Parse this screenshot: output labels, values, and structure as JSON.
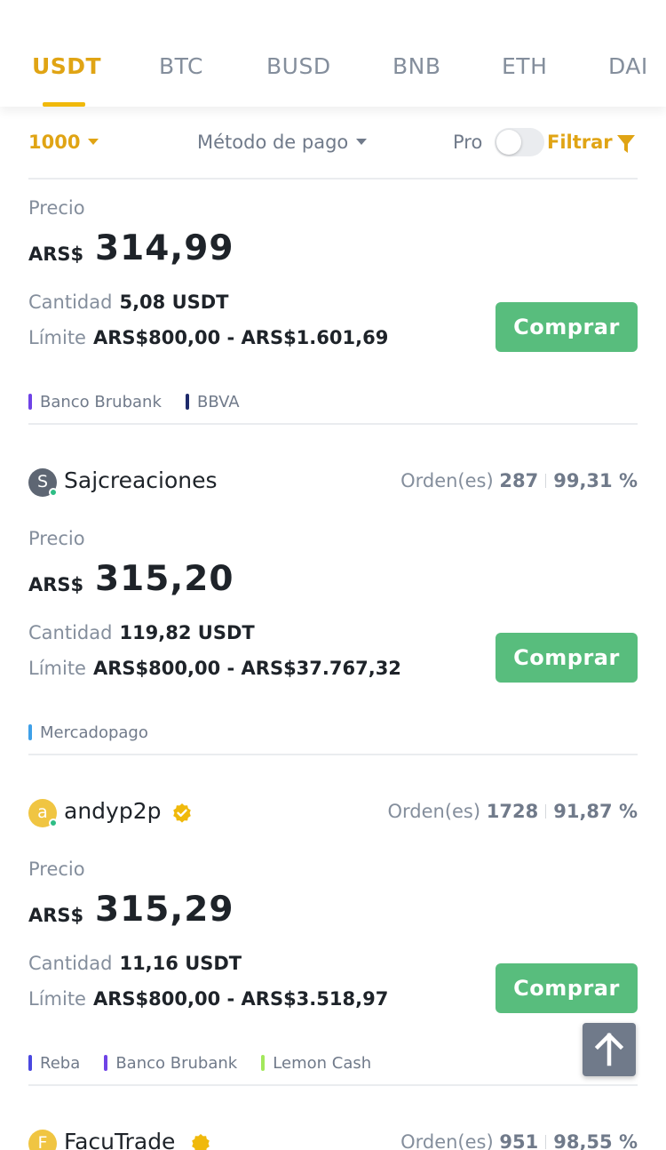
{
  "tabs": [
    {
      "label": "USDT",
      "active": true
    },
    {
      "label": "BTC",
      "active": false
    },
    {
      "label": "BUSD",
      "active": false
    },
    {
      "label": "BNB",
      "active": false
    },
    {
      "label": "ETH",
      "active": false
    },
    {
      "label": "DAI",
      "active": false
    }
  ],
  "filters": {
    "amount": "1000",
    "payment_method": "Método de pago",
    "pro_label": "Pro",
    "pro_enabled": false,
    "filter_label": "Filtrar"
  },
  "labels": {
    "price": "Precio",
    "quantity": "Cantidad",
    "limit": "Límite",
    "buy": "Comprar",
    "orders": "Orden(es)"
  },
  "colors": {
    "accent": "#f0b90b",
    "buy": "#58bd7d"
  },
  "offers": [
    {
      "advertiser": null,
      "currency": "ARS$",
      "price": "314,99",
      "quantity": "5,08 USDT",
      "limit": "ARS$800,00 - ARS$1.601,69",
      "payments": [
        {
          "name": "Banco Brubank",
          "color": "#6f43e6"
        },
        {
          "name": "BBVA",
          "color": "#1e2a6b"
        }
      ]
    },
    {
      "advertiser": {
        "initial": "S",
        "name": "Sajcreaciones",
        "verified": false,
        "avatar_color": "#5e6673",
        "orders": "287",
        "completion": "99,31 %"
      },
      "currency": "ARS$",
      "price": "315,20",
      "quantity": "119,82 USDT",
      "limit": "ARS$800,00 - ARS$37.767,32",
      "payments": [
        {
          "name": "Mercadopago",
          "color": "#3fa0e8"
        }
      ]
    },
    {
      "advertiser": {
        "initial": "a",
        "name": "andyp2p",
        "verified": true,
        "avatar_color": "#f0c542",
        "orders": "1728",
        "completion": "91,87 %"
      },
      "currency": "ARS$",
      "price": "315,29",
      "quantity": "11,16 USDT",
      "limit": "ARS$800,00 - ARS$3.518,97",
      "payments": [
        {
          "name": "Reba",
          "color": "#4a48e0"
        },
        {
          "name": "Banco Brubank",
          "color": "#6f43e6"
        },
        {
          "name": "Lemon Cash",
          "color": "#a3e85c"
        }
      ]
    },
    {
      "advertiser": {
        "initial": "F",
        "name": "FacuTrade",
        "verified": true,
        "avatar_color": "#f0c542",
        "orders": "951",
        "completion": "98,55 %"
      }
    }
  ],
  "scroll_top": {
    "icon": "arrow-up-icon"
  }
}
